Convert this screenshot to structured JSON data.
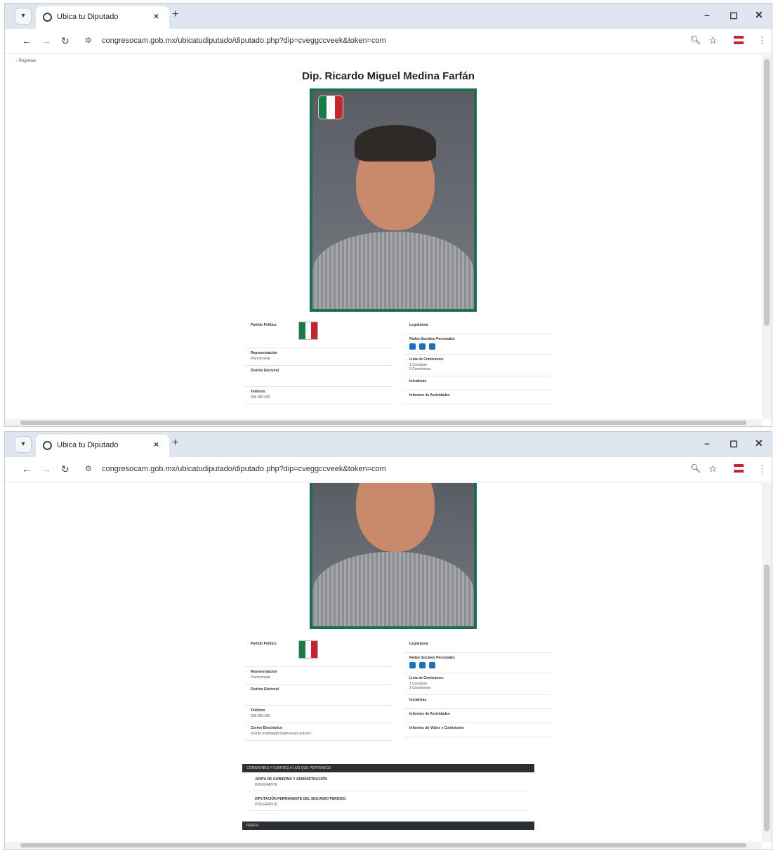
{
  "browser": {
    "tab_title": "Ubica tu Diputado",
    "url": "congresocam.gob.mx/ubicatudiputado/diputado.php?dip=cveggccveek&token=com",
    "new_tab_label": "+",
    "tab_close_label": "×"
  },
  "page": {
    "breadcrumb": "‹ Regresar",
    "title": "Dip. Ricardo Miguel Medina Farfán"
  },
  "party_colors": {
    "green": "#1c7a46",
    "white": "#ffffff",
    "red": "#c4262e"
  },
  "profile": {
    "left": [
      {
        "label": "Partido Político",
        "value": ""
      },
      {
        "label": "Representación",
        "value": "Plurinominal"
      },
      {
        "label": "Distrito Electoral",
        "value": ""
      },
      {
        "label": "Teléfono",
        "value": "000 000 000"
      },
      {
        "label": "Correo Electrónico",
        "value": "ricardo.medina@congresocam.gob.mx"
      }
    ],
    "right": [
      {
        "label": "Legislatura",
        "value": ""
      },
      {
        "label": "Redes Sociales Personales",
        "value": ""
      },
      {
        "label": "Lista de Comisiones",
        "value": "1 Comisión\n2 Comisiones"
      },
      {
        "label": "Iniciativas",
        "value": ""
      },
      {
        "label": "Informes de Actividades",
        "value": ""
      },
      {
        "label": "Informes de Viajes y Comisiones",
        "value": ""
      }
    ]
  },
  "sections": {
    "commissions_header": "COMISIONES Y COMITÉS A LOS QUE PERTENECE",
    "commissions": [
      {
        "name": "JUNTA DE GOBIERNO Y ADMINISTRACIÓN",
        "role": "INTEGRANTE"
      },
      {
        "name": "DIPUTACIÓN PERMANENTE DEL SEGUNDO PERIODO",
        "role": "INTEGRANTE"
      }
    ],
    "footer_header": "PERFIL"
  }
}
